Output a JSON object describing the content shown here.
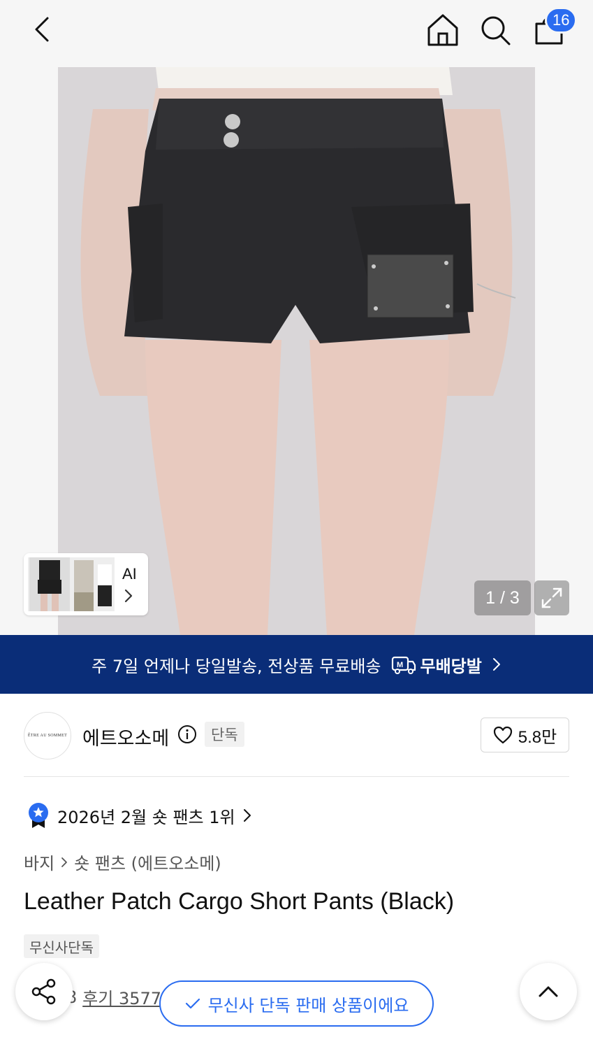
{
  "header": {
    "cart_count": "16"
  },
  "gallery": {
    "counter": "1 / 3",
    "thumb_label": "AI"
  },
  "shipping_banner": {
    "text": "주 7일 언제나 당일발송, 전상품 무료배송",
    "brand": "무배당발"
  },
  "brand": {
    "logo_text": "ÊTRE AU SOMMET",
    "name": "에트오소메",
    "tag": "단독",
    "likes": "5.8만"
  },
  "ranking": {
    "text": "2026년 2월 숏 팬츠 1위"
  },
  "breadcrumb": {
    "category": "바지",
    "subcategory": "숏 팬츠 (에트오소메)"
  },
  "product": {
    "title": "Leather Patch Cargo Short Pants (Black)",
    "tag": "무신사단독",
    "rating": "4.8",
    "reviews": "후기 3577"
  },
  "bottom": {
    "exclusive_notice": "무신사 단독 판매 상품이에요"
  },
  "colors": {
    "accent": "#2a6cf0",
    "banner": "#0a2d78"
  }
}
